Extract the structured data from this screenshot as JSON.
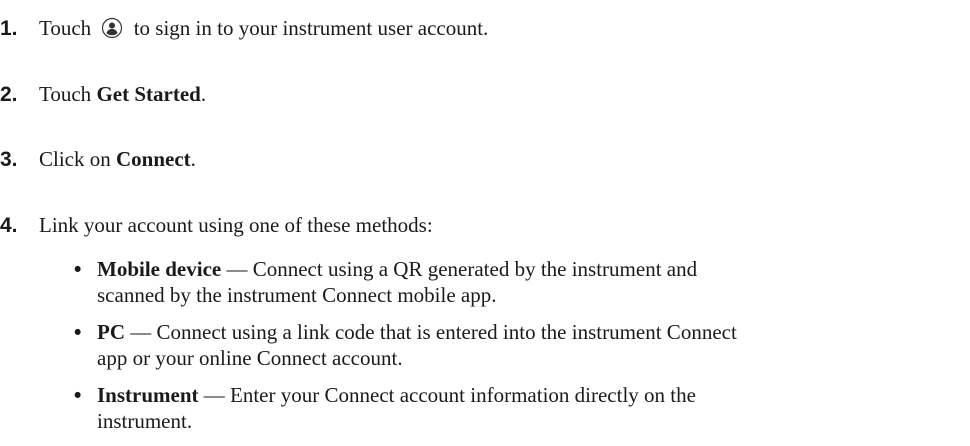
{
  "steps": [
    {
      "number": "1.",
      "before": "Touch",
      "icon": "user-account-icon",
      "after": "to sign in to your instrument user account."
    },
    {
      "number": "2.",
      "before": "Touch ",
      "bold": "Get Started",
      "after": "."
    },
    {
      "number": "3.",
      "before": "Click on ",
      "bold": "Connect",
      "after": "."
    },
    {
      "number": "4.",
      "text": "Link your account using one of these methods:"
    }
  ],
  "methods": [
    {
      "bullet": "•",
      "title": "Mobile device",
      "desc": " — Connect using a QR generated by the instrument and",
      "desc2": "scanned by the instrument Connect mobile app."
    },
    {
      "bullet": "•",
      "title": "PC",
      "desc": " — Connect using a link code that is entered into the instrument Connect",
      "desc2": "app or your online Connect account."
    },
    {
      "bullet": "•",
      "title": "Instrument",
      "desc": " — Enter your Connect account information directly on the",
      "desc2": "instrument."
    }
  ]
}
